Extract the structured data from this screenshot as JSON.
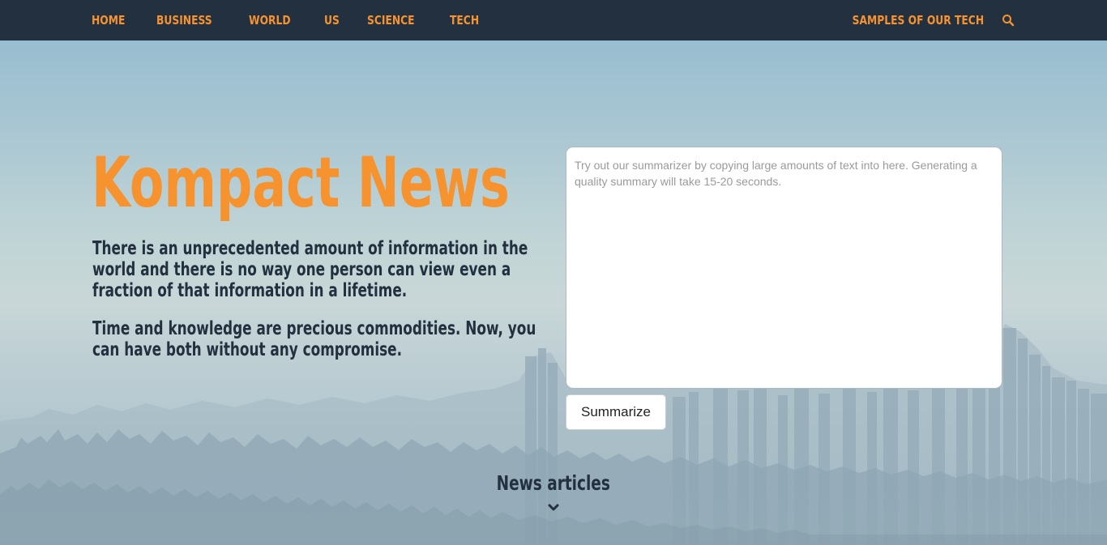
{
  "nav": {
    "items": [
      {
        "label": "HOME"
      },
      {
        "label": "BUSINESS"
      },
      {
        "label": "WORLD"
      },
      {
        "label": "US"
      },
      {
        "label": "SCIENCE"
      },
      {
        "label": "TECH"
      }
    ],
    "samples_label": "SAMPLES OF OUR TECH",
    "search_icon": "search-icon"
  },
  "hero": {
    "title": "Kompact News",
    "paragraph1": "There is an unprecedented amount of information in the world and there is no way one person can view even a fraction of that information in a lifetime.",
    "paragraph2": "Time and knowledge are precious commodities. Now, you can have both without any compromise."
  },
  "summarizer": {
    "placeholder": "Try out our summarizer by copying large amounts of text into here. Generating a quality summary will take 15-20 seconds.",
    "value": "",
    "button_label": "Summarize"
  },
  "news": {
    "label": "News articles",
    "icon": "chevron-down-icon"
  },
  "colors": {
    "navbar_bg": "#22303f",
    "accent_orange": "#f7932f",
    "dark_text": "#22303f"
  }
}
